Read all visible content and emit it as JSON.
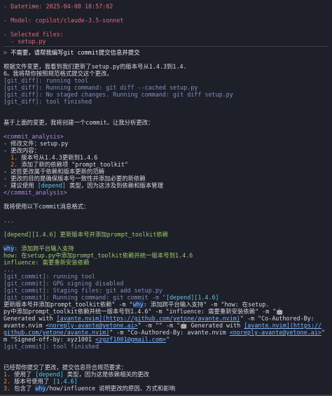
{
  "header": {
    "datetime_line": "- Datetime: 2025-04-08 18:57:02",
    "model_line": "- Model: copilot/claude-3.5-sonnet",
    "files_label": "- Selected files:",
    "file_item": "  - setup.py"
  },
  "prompt": {
    "marker": "> ",
    "text": "不需要，请帮我编写git commit提交信息并提交"
  },
  "response": {
    "intro_1": "根据文件变更，我看到我们更新了setup.py的版本号从1.4.3到1.4.",
    "intro_2": "6。我将帮你按照规范格式提交这个更改。",
    "tool_1": "[git_diff]: running tool",
    "tool_2": "[git_diff]: Running command: git diff --cached setup.py",
    "tool_3": "[git_diff]: No staged changes. Running command: git diff setup.py",
    "tool_4": "[git_diff]: tool finished",
    "analysis_lead": "基于上面的变更，我将创建一个commit。让我分析更改：",
    "analysis_open": "<commit_analysis>",
    "analysis_1": "- 修改文件：setup.py",
    "analysis_2": "- 更改内容：",
    "analysis_2a_num": "  1.",
    "analysis_2a": " 版本号从1.4.3更新到1.4.6",
    "analysis_2b_num": "  2.",
    "analysis_2b": " 添加了新的依赖项 \"prompt_toolkit\"",
    "analysis_3": "- 这些更改属于依赖和版本更新的范畴",
    "analysis_4": "- 更改的目的是确保版本号一致性并添加必要的新依赖",
    "analysis_5a": "- 建议使用 ",
    "analysis_5b": "[depend]",
    "analysis_5c": " 类型，因为这涉及到依赖和版本管理",
    "analysis_close": "</commit_analysis>",
    "format_lead": "我将使用以下commit消息格式：",
    "ellipsis": "...",
    "commit_title": "[depend][1.4.6] 更新版本号并添加prompt_toolkit依赖",
    "why_label": "why",
    "why_text": ": 添加跨平台输入支持",
    "how_text": "how: 在setup.py中添加prompt_toolkit依赖并统一版本号到1.4.6",
    "influence_text": "influence: 需要重新安装依赖",
    "ellipsis2": "...",
    "gc_1": "[git_commit]: running tool",
    "gc_2": "[git_commit]: GPG signing disabled",
    "gc_3": "[git_commit]: Staging files: git add setup.py",
    "gc_4a": "[git_commit]: Running command: git commit -m \"",
    "gc_4b": "[depend][1.4.6]",
    "gc_5a": "更新版本号并添加prompt_toolkit依赖\" -m \"",
    "gc_5b": "why",
    "gc_5c": ": 添加跨平台输入支持\" -m \"how: 在setup.",
    "gc_6": "py中添加prompt_toolkit依赖并统一版本号到1.4.6\" -m \"influence: 需要重新安装依赖\" -m \"🤖",
    "gc_7a": "Generated with ",
    "gc_7b": "[avante.nvim](https://github.com/yetone/avante.nvim)",
    "gc_7c": "\" -m \"Co-Authored-By:",
    "gc_8a": "avante.nvim ",
    "gc_8b": "<noreply-avante@yetone.ai>",
    "gc_8c": "\" -m \"\" -m \"🤖 Generated with ",
    "gc_8d": "[avante.nvim](https://",
    "gc_9a": "github.com/yetone/avante.nvim)",
    "gc_9b": "\" -m \"Co-Authored-By: avante.nvim ",
    "gc_9c": "<noreply-avante@yetone.ai>",
    "gc_9d": "\" -",
    "gc_10a": "m \"Signed-off-by: xyz1001 ",
    "gc_10b": "<zgzf1001@gmail.com>",
    "gc_10c": "\"",
    "gc_11": "[git_commit]: tool finished",
    "summary_lead": "已经帮你提交了更改，提交信息符合规范要求：",
    "summary_1_num": "1.",
    "summary_1a": " 使用了 ",
    "summary_1b": "[depend]",
    "summary_1c": " 类型，因为这是依赖相关的更改",
    "summary_2_num": "2.",
    "summary_2a": " 版本号使用了 ",
    "summary_2b": "[1.4.6]",
    "summary_3_num": "3.",
    "summary_3a": " 包含了 ",
    "summary_3b": "why",
    "summary_3c": "/how/influence 说明更改的原因、方式和影响"
  }
}
